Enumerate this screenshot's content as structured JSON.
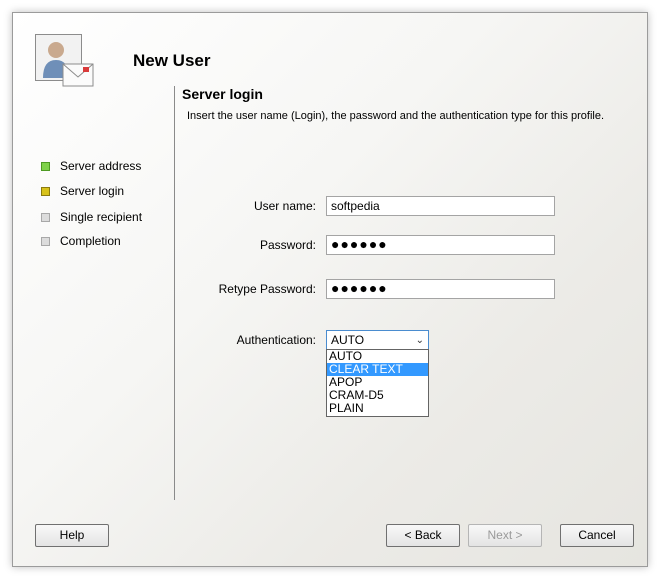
{
  "header": {
    "title": "New User"
  },
  "page": {
    "title": "Server login",
    "description": "Insert the user name (Login), the password and the authentication type for this profile."
  },
  "steps": [
    {
      "label": "Server address",
      "state": "done"
    },
    {
      "label": "Server login",
      "state": "current"
    },
    {
      "label": "Single recipient",
      "state": "todo"
    },
    {
      "label": "Completion",
      "state": "todo"
    }
  ],
  "form": {
    "username_label": "User name:",
    "username_value": "softpedia",
    "password_label": "Password:",
    "password_value": "●●●●●●",
    "retype_label": "Retype Password:",
    "retype_value": "●●●●●●",
    "auth_label": "Authentication:",
    "auth_value": "AUTO",
    "auth_options": [
      "AUTO",
      "CLEAR TEXT",
      "APOP",
      "CRAM-D5",
      "PLAIN"
    ]
  },
  "buttons": {
    "help": "Help",
    "back": "< Back",
    "next": "Next >",
    "cancel": "Cancel"
  },
  "colors": {
    "highlight": "#3399ff",
    "step_done": "#7fd24a",
    "step_current": "#d8c21a"
  }
}
